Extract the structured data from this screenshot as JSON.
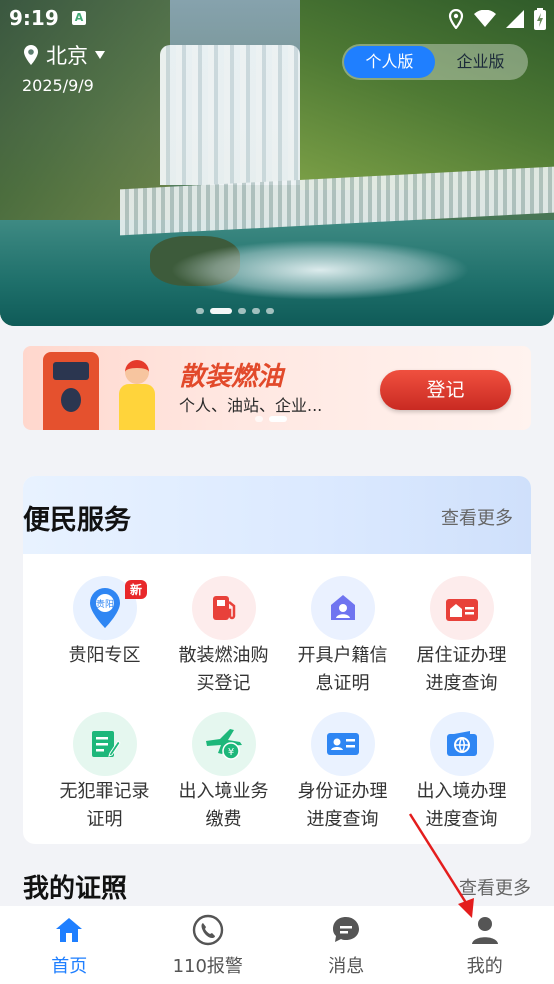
{
  "status_bar": {
    "time": "9:19",
    "badge": "A"
  },
  "location": {
    "city": "北京",
    "date": "2025/9/9"
  },
  "version_toggle": {
    "options": [
      "个人版",
      "企业版"
    ],
    "selected": "个人版",
    "accent": "#1f7fff"
  },
  "banner": {
    "title": "散装燃油",
    "subtitle": "个人、油站、企业...",
    "button_label": "登记"
  },
  "services": {
    "title": "便民服务",
    "more_label": "查看更多",
    "items": [
      {
        "label": "贵阳专区",
        "icon": "location-pin-icon",
        "badge": "新",
        "badge_text": "贵阳"
      },
      {
        "label": "散装燃油购买登记",
        "icon": "fuel-pump-icon"
      },
      {
        "label": "开具户籍信息证明",
        "icon": "person-house-icon"
      },
      {
        "label": "居住证办理进度查询",
        "icon": "residence-card-icon"
      },
      {
        "label": "无犯罪记录证明",
        "icon": "document-edit-icon"
      },
      {
        "label": "出入境业务缴费",
        "icon": "airplane-yuan-icon"
      },
      {
        "label": "身份证办理进度查询",
        "icon": "id-card-icon"
      },
      {
        "label": "出入境办理进度查询",
        "icon": "passport-globe-icon"
      }
    ]
  },
  "licenses": {
    "title": "我的证照",
    "more_label": "查看更多"
  },
  "bottom_nav": {
    "items": [
      {
        "label": "首页",
        "icon": "home-icon",
        "active": true
      },
      {
        "label": "110报警",
        "icon": "phone-icon",
        "active": false
      },
      {
        "label": "消息",
        "icon": "message-icon",
        "active": false
      },
      {
        "label": "我的",
        "icon": "user-icon",
        "active": false
      }
    ]
  }
}
